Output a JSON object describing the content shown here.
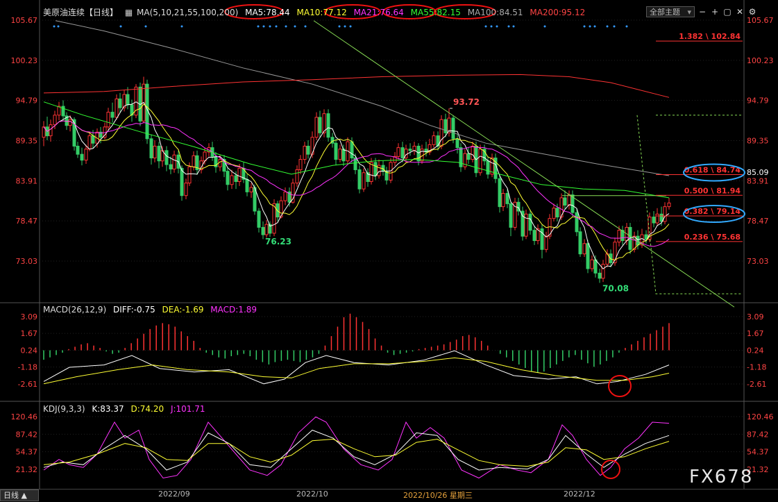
{
  "main_header": {
    "title": "美原油连续【日线】",
    "ma_label": "MA(5,10,21,55,100,200)",
    "ma5": "MA5:78.44",
    "ma10": "MA10:77.12",
    "ma21": "MA21:76.64",
    "ma55": "MA55:82.15",
    "ma100": "MA100:84.51",
    "ma200": "MA200:95.12"
  },
  "toolbar": {
    "theme_label": "全部主题"
  },
  "macd_header": {
    "label": "MACD(26,12,9)",
    "diff": "DIFF:-0.75",
    "dea": "DEA:-1.69",
    "macd": "MACD:1.89"
  },
  "kdj_header": {
    "label": "KDJ(9,3,3)",
    "k": "K:83.37",
    "d": "D:74.20",
    "j": "J:101.71"
  },
  "bottom": {
    "period": "日线",
    "dates": [
      "2022/09",
      "2022/10",
      "2022/10/26 星期三",
      "2022/12"
    ]
  },
  "watermark": "FX678",
  "chart_data": {
    "type": "candlestick",
    "main_axis": {
      "ticks": [
        "105.67",
        "100.23",
        "94.79",
        "89.35",
        "83.91",
        "78.47",
        "73.03"
      ],
      "right_extra": "85.09"
    },
    "fib_levels": [
      {
        "label": "1.382 \\ 102.84",
        "value": 102.84
      },
      {
        "label": "0.618 \\ 84.74",
        "value": 84.74
      },
      {
        "label": "0.500 \\ 81.94",
        "value": 81.94
      },
      {
        "label": "0.382 \\ 79.14",
        "value": 79.14
      },
      {
        "label": "0.236 \\ 75.68",
        "value": 75.68
      }
    ],
    "annotations": [
      {
        "text": "93.72",
        "value": 93.72
      },
      {
        "text": "76.23",
        "value": 76.23
      },
      {
        "text": "70.08",
        "value": 70.08
      }
    ],
    "macd_axis": [
      "3.09",
      "1.67",
      "0.24",
      "-1.18",
      "-2.61"
    ],
    "kdj_axis": [
      "120.46",
      "87.42",
      "54.37",
      "21.32"
    ],
    "colors": {
      "up": "#ff3333",
      "down": "#33cc66",
      "ma5": "#ffffff",
      "ma10": "#ffff33",
      "ma21": "#ff33ff",
      "ma55": "#33ff33",
      "ma100": "#999999",
      "ma200": "#ff3333"
    }
  }
}
